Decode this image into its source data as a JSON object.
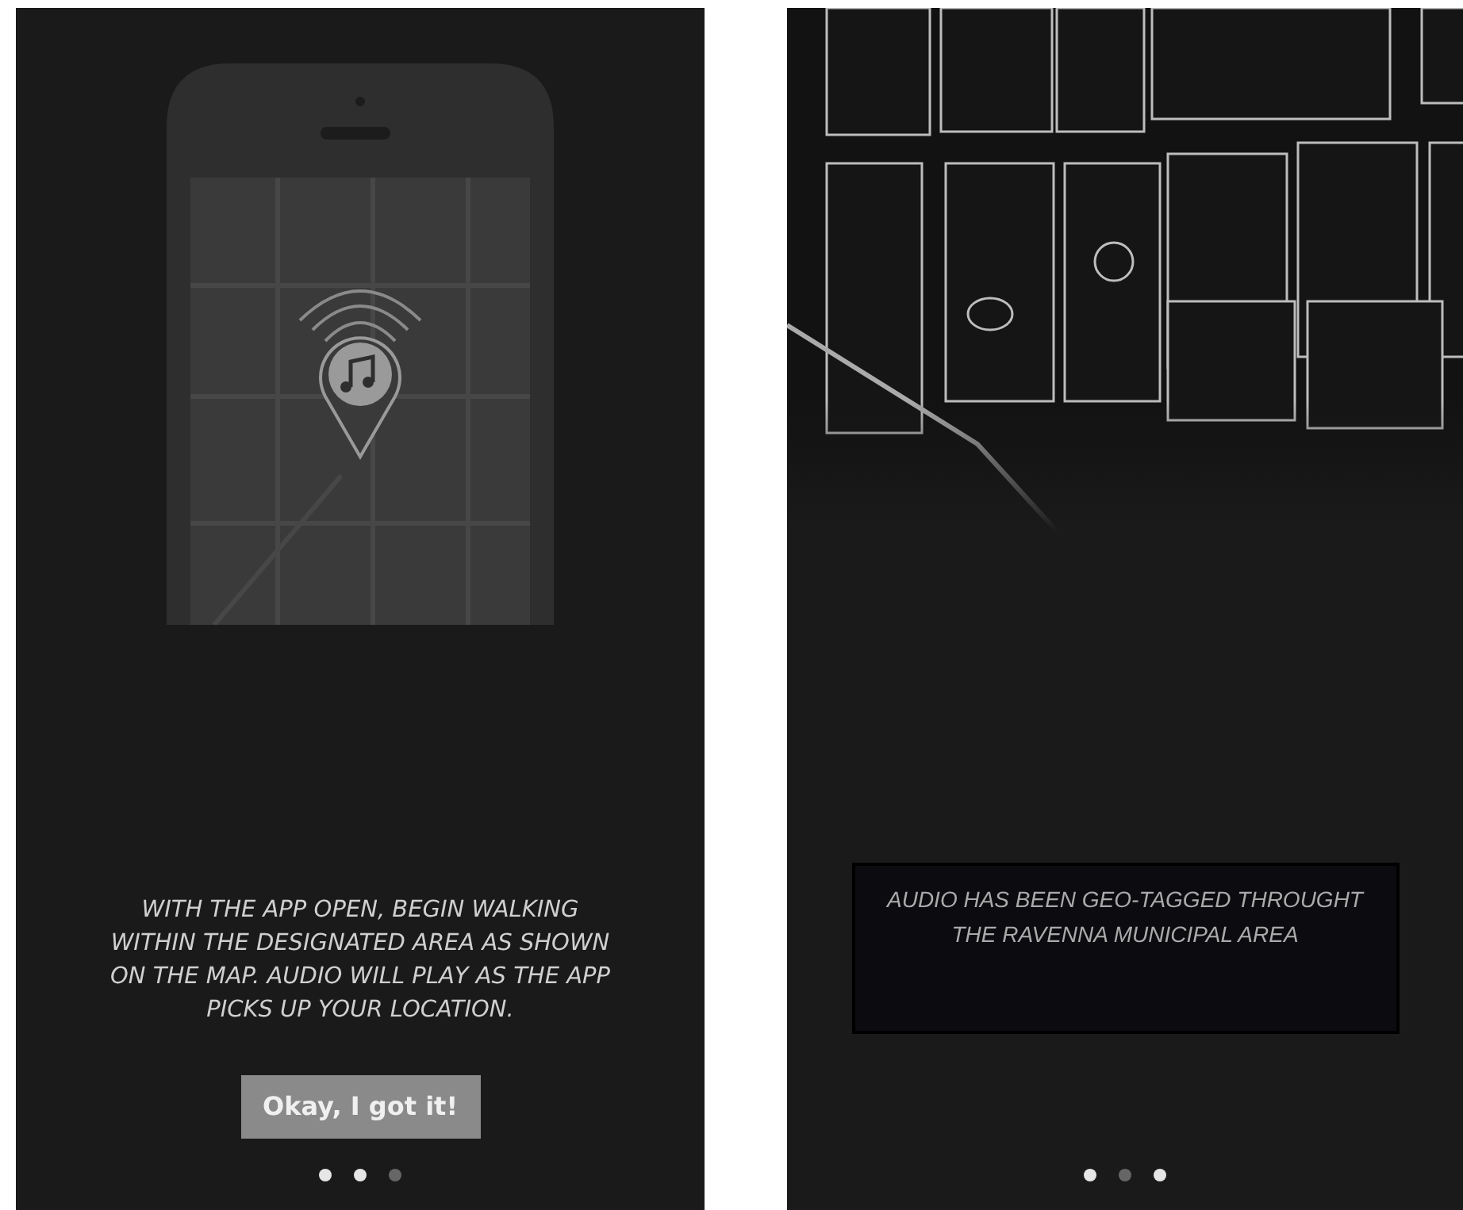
{
  "screens": [
    {
      "kind": "intro",
      "caption": "WITH THE APP OPEN, BEGIN WALKING WITHIN THE DESIGNATED AREA AS SHOWN ON THE MAP. AUDIO WILL PLAY AS THE APP PICKS UP YOUR LOCATION.",
      "button": "Okay, I got it!",
      "dots": [
        {
          "selected": true
        },
        {
          "selected": true
        },
        {
          "selected": false
        }
      ]
    },
    {
      "kind": "map",
      "message": "AUDIO HAS BEEN GEO-TAGGED THROUGHT THE RAVENNA MUNICIPAL AREA",
      "dots": [
        {
          "selected": true
        },
        {
          "selected": false
        },
        {
          "selected": true
        }
      ]
    }
  ]
}
